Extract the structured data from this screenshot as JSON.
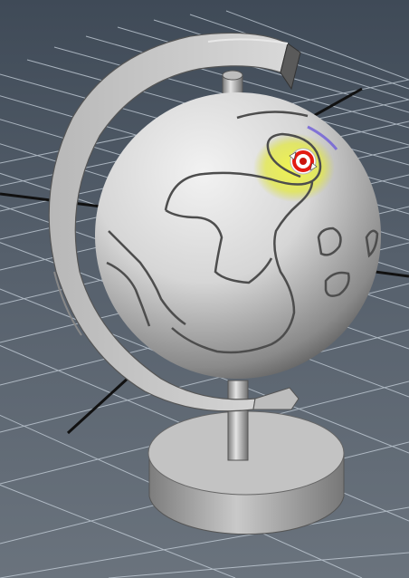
{
  "viewport": {
    "panel": "perspective-viewport",
    "object": "globe-model",
    "background_top": "#3f4a57",
    "background_bottom": "#6a737d",
    "grid_color": "#c9d3dd",
    "axis_color": "#111111",
    "model_color": "#c8c8c8",
    "soft_select_color": "#e8ef3a",
    "manipulator_ring_color": "#e31b12",
    "manipulator_icon": "rotate-manipulator-icon"
  }
}
